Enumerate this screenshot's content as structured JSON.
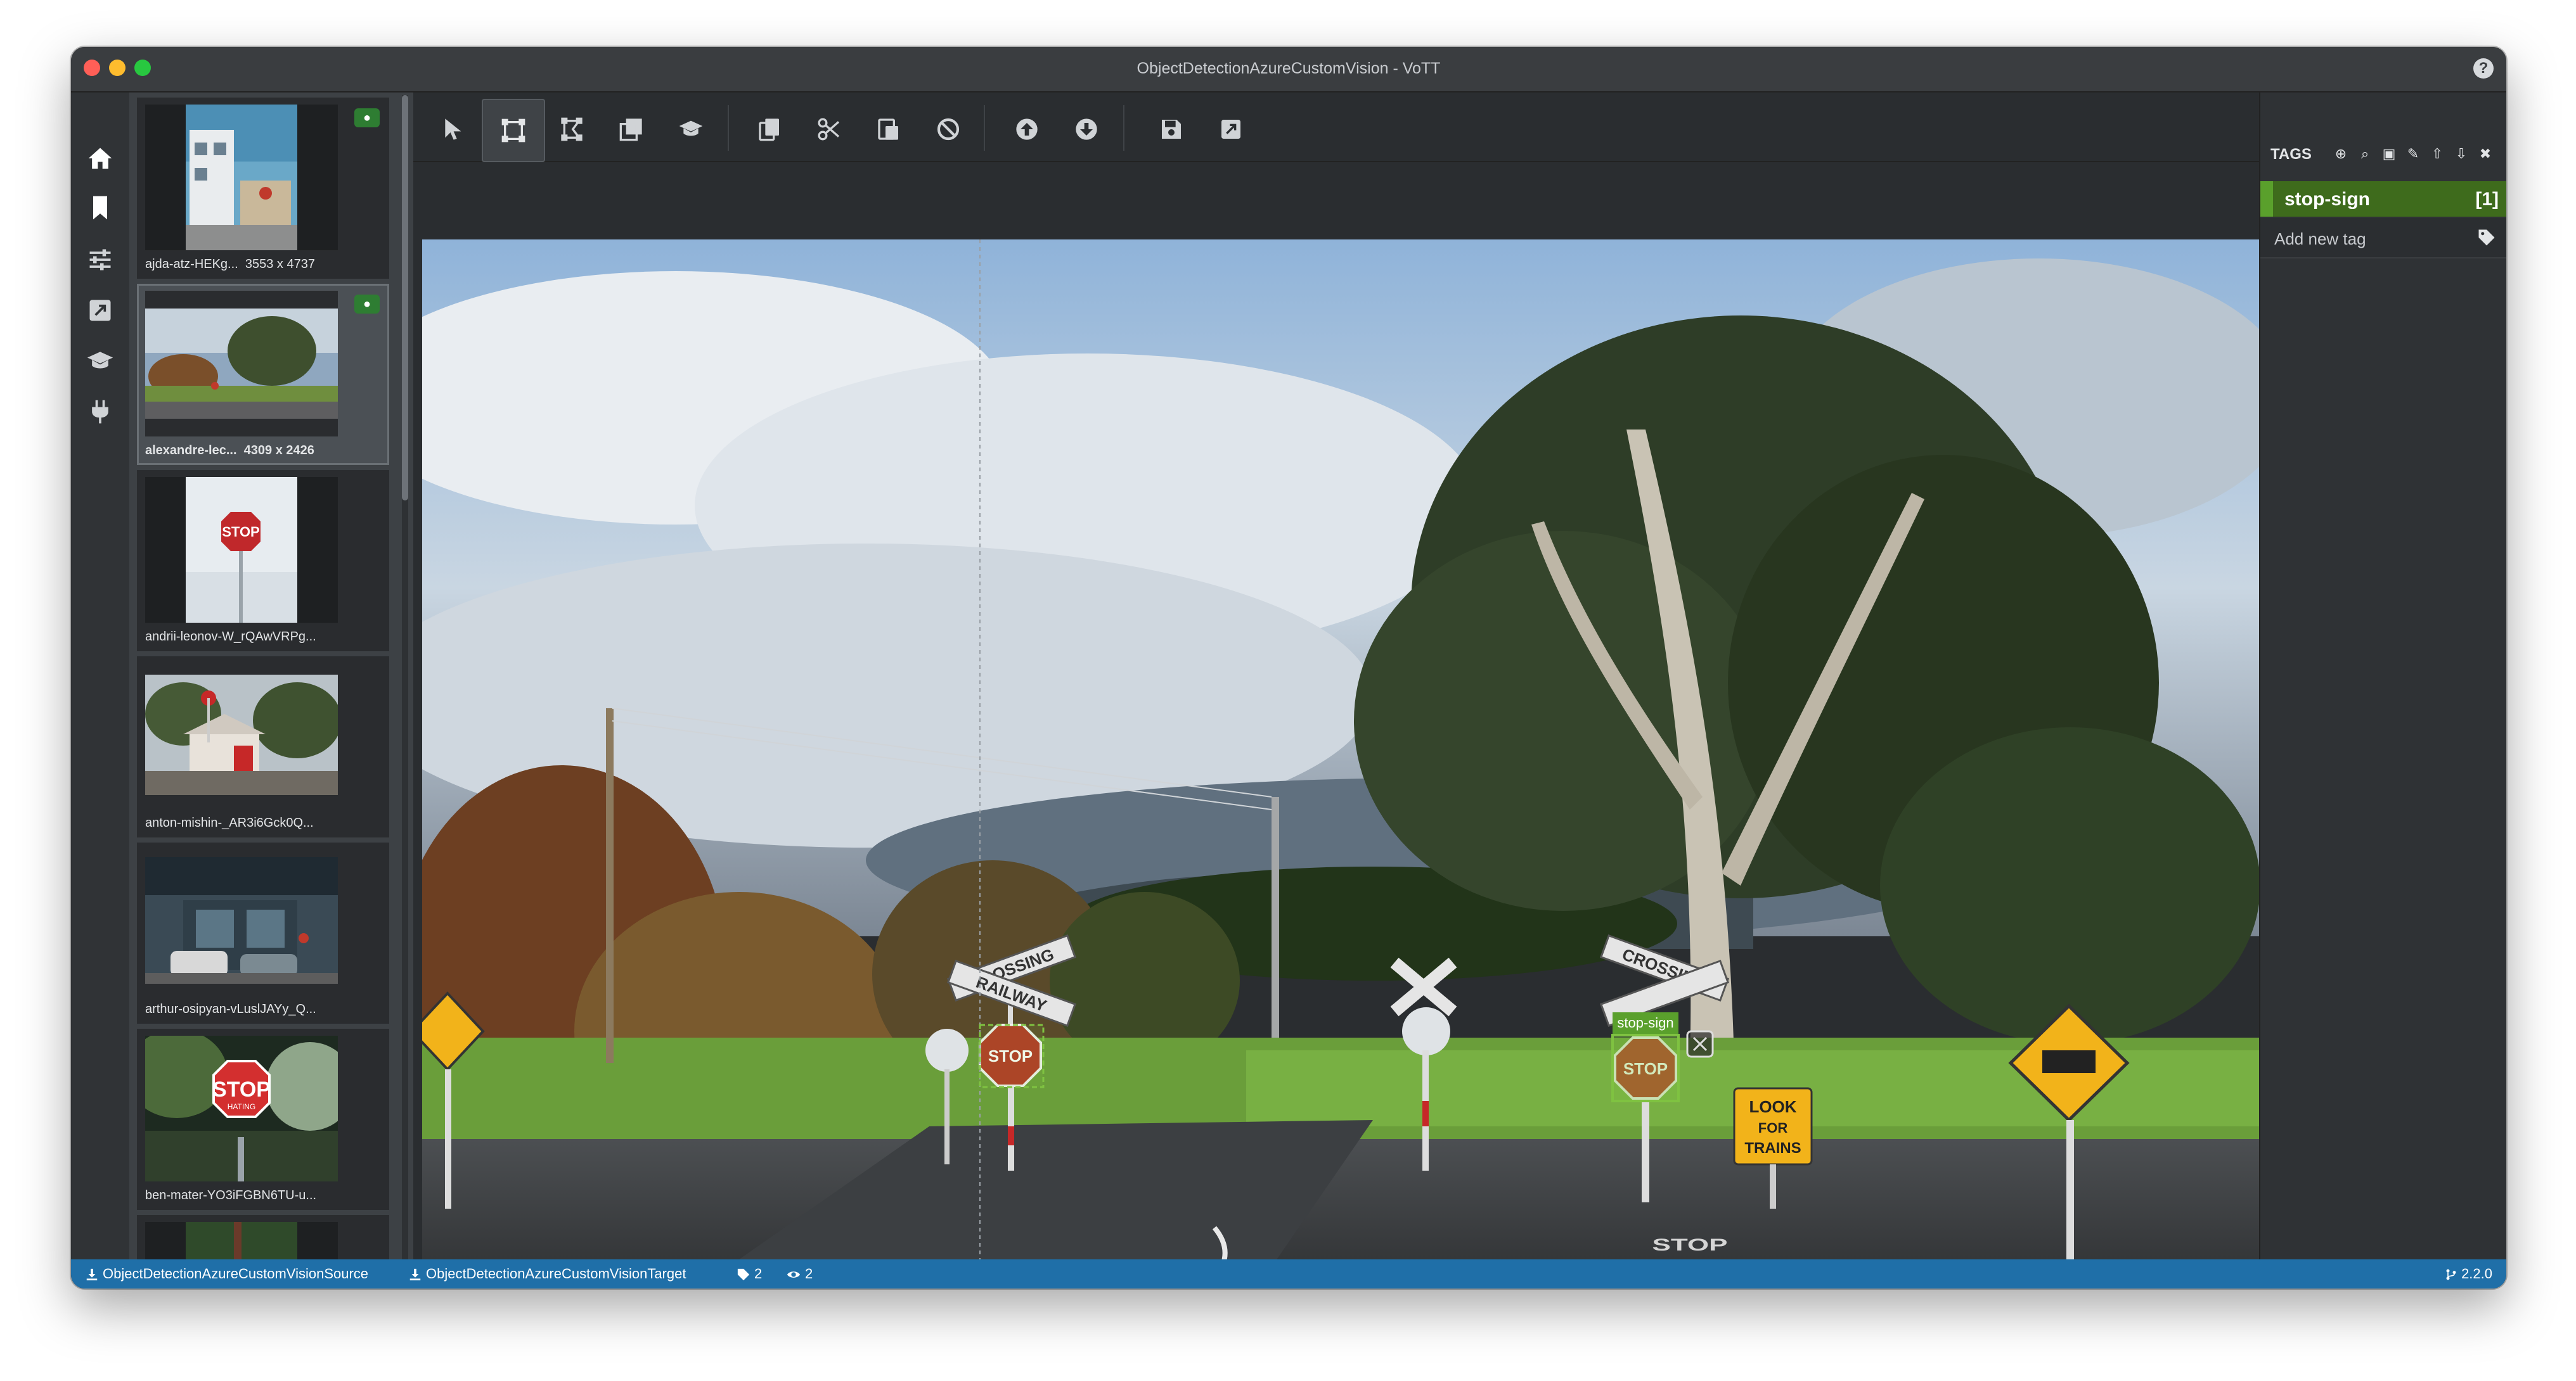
{
  "window": {
    "title": "ObjectDetectionAzureCustomVision - VoTT"
  },
  "leftnav": {
    "items": [
      "home-icon",
      "bookmark-icon",
      "sliders-icon",
      "export-icon",
      "graduation-cap-icon",
      "plug-icon"
    ],
    "settings": "gear-icon"
  },
  "thumbnails": [
    {
      "name": "ajda-atz-HEKg...",
      "size": "3553 x 4737",
      "tagged": true,
      "active": false
    },
    {
      "name": "alexandre-lec...",
      "size": "4309 x 2426",
      "tagged": true,
      "active": true
    },
    {
      "name": "andrii-leonov-W_rQAwVRPg...",
      "size": "",
      "tagged": false,
      "active": false
    },
    {
      "name": "anton-mishin-_AR3i6Gck0Q...",
      "size": "",
      "tagged": false,
      "active": false
    },
    {
      "name": "arthur-osipyan-vLuslJAYy_Q...",
      "size": "",
      "tagged": false,
      "active": false
    },
    {
      "name": "ben-mater-YO3iFGBN6TU-u...",
      "size": "",
      "tagged": false,
      "active": false
    }
  ],
  "thumb_images": {
    "img0_stop_sign_text": "STOP",
    "img2_stop_sign_text": "STOP",
    "img5_stop_text": "STOP",
    "img5_sub_text": "HATING"
  },
  "toolbar": {
    "buttons": [
      "pointer-icon",
      "rectangle-icon",
      "polygon-icon",
      "copy-rect-icon",
      "active-learning-icon",
      "copy-icon",
      "cut-icon",
      "paste-icon",
      "clear-icon",
      "previous-icon",
      "next-icon",
      "save-icon",
      "export-icon"
    ],
    "active": "rectangle-icon"
  },
  "canvas": {
    "region_tag": "stop-sign",
    "sign_texts": {
      "crossing_left_top": "CROSSING",
      "railway_left": "RAILWAY",
      "stop_left": "STOP",
      "stop_right": "STOP",
      "look_for_trains_1": "LOOK",
      "look_for_trains_2": "FOR",
      "look_for_trains_3": "TRAINS",
      "road_stop": "STOP"
    }
  },
  "tags_panel": {
    "title": "TAGS",
    "tools": [
      "add-icon",
      "search-icon",
      "lock-icon",
      "edit-icon",
      "move-up-icon",
      "move-down-icon",
      "delete-icon"
    ],
    "tags": [
      {
        "name": "stop-sign",
        "count": "[1]"
      }
    ],
    "add_placeholder": "Add new tag"
  },
  "statusbar": {
    "source": "ObjectDetectionAzureCustomVisionSource",
    "target": "ObjectDetectionAzureCustomVisionTarget",
    "tag_count": "2",
    "visited_count": "2",
    "version": "2.2.0"
  },
  "colors": {
    "accent_green": "#5aa02c",
    "tag_bg": "#3e6b1c",
    "status_blue": "#1f6fa8",
    "region_green": "#7fc241"
  }
}
